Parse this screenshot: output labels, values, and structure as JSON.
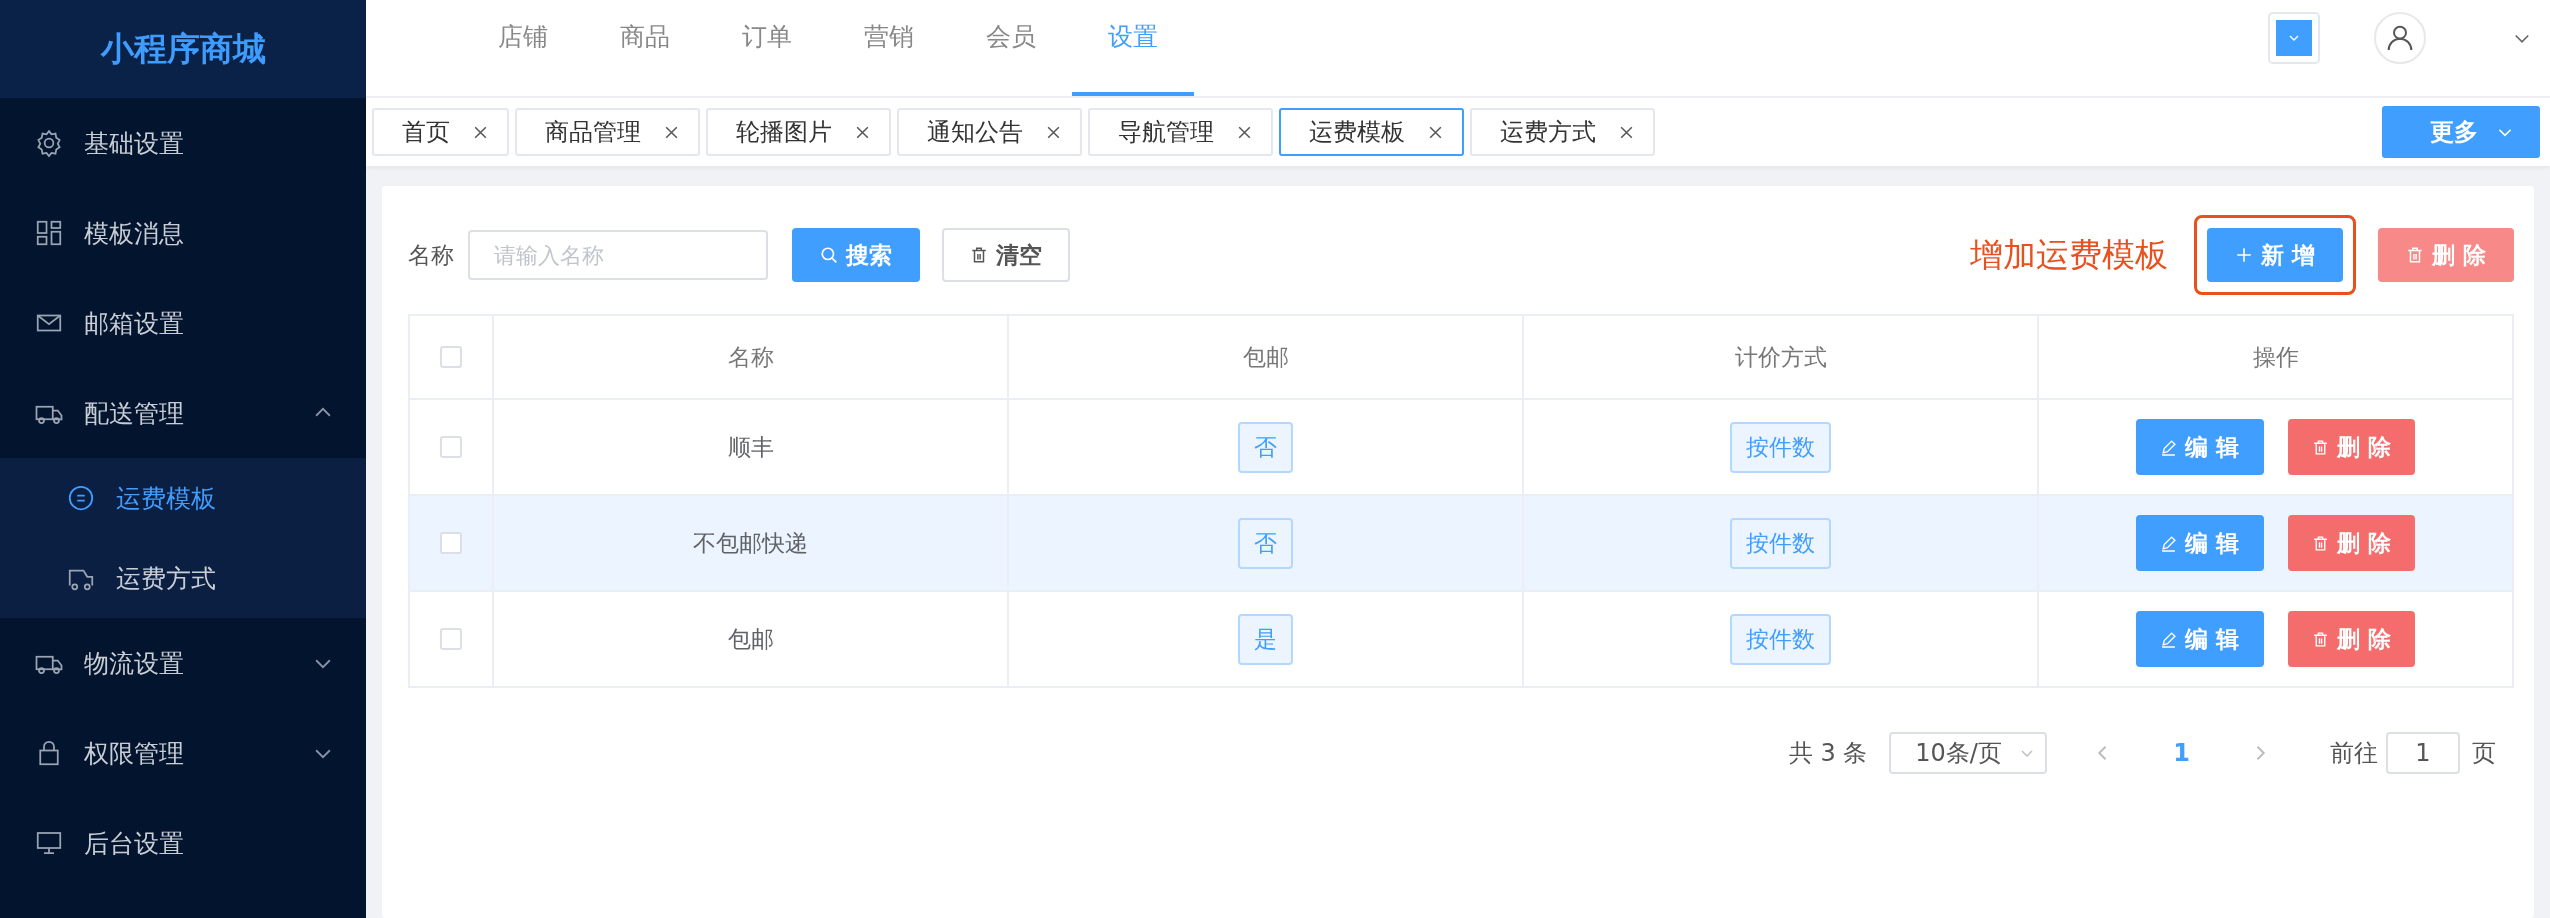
{
  "sidebar": {
    "logo": "小程序商城",
    "items": [
      {
        "label": "基础设置"
      },
      {
        "label": "模板消息"
      },
      {
        "label": "邮箱设置"
      },
      {
        "label": "配送管理",
        "expanded": true,
        "children": [
          {
            "label": "运费模板",
            "selected": true
          },
          {
            "label": "运费方式",
            "selected": false
          }
        ]
      },
      {
        "label": "物流设置",
        "expanded": false
      },
      {
        "label": "权限管理",
        "expanded": false
      },
      {
        "label": "后台设置"
      }
    ]
  },
  "top_nav": [
    {
      "label": "店铺",
      "selected": false
    },
    {
      "label": "商品",
      "selected": false
    },
    {
      "label": "订单",
      "selected": false
    },
    {
      "label": "营销",
      "selected": false
    },
    {
      "label": "会员",
      "selected": false
    },
    {
      "label": "设置",
      "selected": true
    }
  ],
  "tabs": [
    {
      "label": "首页",
      "selected": false
    },
    {
      "label": "商品管理",
      "selected": false
    },
    {
      "label": "轮播图片",
      "selected": false
    },
    {
      "label": "通知公告",
      "selected": false
    },
    {
      "label": "导航管理",
      "selected": false
    },
    {
      "label": "运费模板",
      "selected": true
    },
    {
      "label": "运费方式",
      "selected": false
    }
  ],
  "more_button": "更多",
  "toolbar": {
    "name_label": "名称",
    "placeholder": "请输入名称",
    "search_button": "搜索",
    "clear_button": "清空",
    "annotation": "增加运费模板",
    "add_button": "新 增",
    "delete_button": "删 除"
  },
  "table": {
    "header_checked": false,
    "columns": [
      "名称",
      "包邮",
      "计价方式",
      "操作"
    ],
    "rows": [
      {
        "checked": false,
        "highlighted": false,
        "name": "顺丰",
        "free_shipping": "否",
        "pricing": "按件数",
        "edit": "编 辑",
        "delete": "删 除"
      },
      {
        "checked": false,
        "highlighted": true,
        "name": "不包邮快递",
        "free_shipping": "否",
        "pricing": "按件数",
        "edit": "编 辑",
        "delete": "删 除"
      },
      {
        "checked": false,
        "highlighted": false,
        "name": "包邮",
        "free_shipping": "是",
        "pricing": "按件数",
        "edit": "编 辑",
        "delete": "删 除"
      }
    ]
  },
  "pagination": {
    "total": "共 3 条",
    "page_size": "10条/页",
    "pages": [
      {
        "label": "1",
        "selected": true
      }
    ],
    "goto_label": "前往",
    "goto_value": "1",
    "goto_suffix": "页"
  }
}
